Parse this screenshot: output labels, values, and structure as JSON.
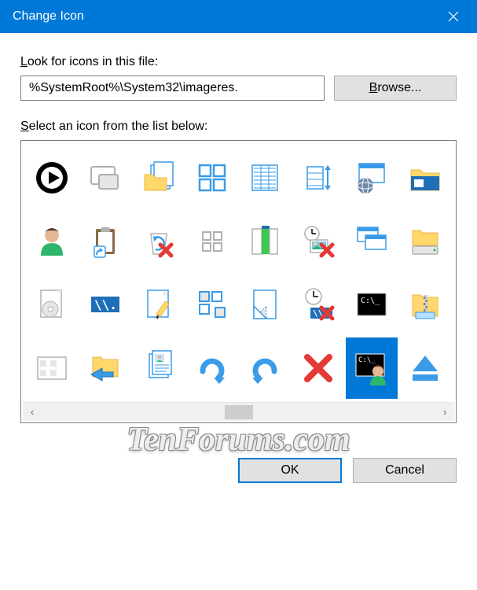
{
  "title": "Change Icon",
  "lookLabelPrefixUnderline": "L",
  "lookLabelRest": "ook for icons in this file:",
  "filePath": "%SystemRoot%\\System32\\imageres.",
  "browseUnderline": "B",
  "browseRest": "rowse...",
  "selectLabelPrefixUnderline": "S",
  "selectLabelRest": "elect an icon from the list below:",
  "okLabel": "OK",
  "cancelLabel": "Cancel",
  "watermark": "TenForums.com",
  "icons": [
    "play-circle",
    "screen-mirror",
    "folder-copy",
    "grid-four",
    "list-detail",
    "resize-vertical",
    "window-globe",
    "folder-explorer",
    "user-head",
    "clipboard-shortcut",
    "recycle-delete",
    "grid-small",
    "panel-green",
    "time-picture-delete",
    "window-cascade",
    "drive-folder",
    "page-disc",
    "network-path",
    "page-pencil",
    "grid-offset",
    "page-fold",
    "time-network",
    "command-prompt",
    "zip-folder",
    "layout-tiles",
    "folder-back",
    "page-contact",
    "redo",
    "undo",
    "delete-x",
    "cmd-user",
    "eject"
  ],
  "selectedIndex": 30
}
